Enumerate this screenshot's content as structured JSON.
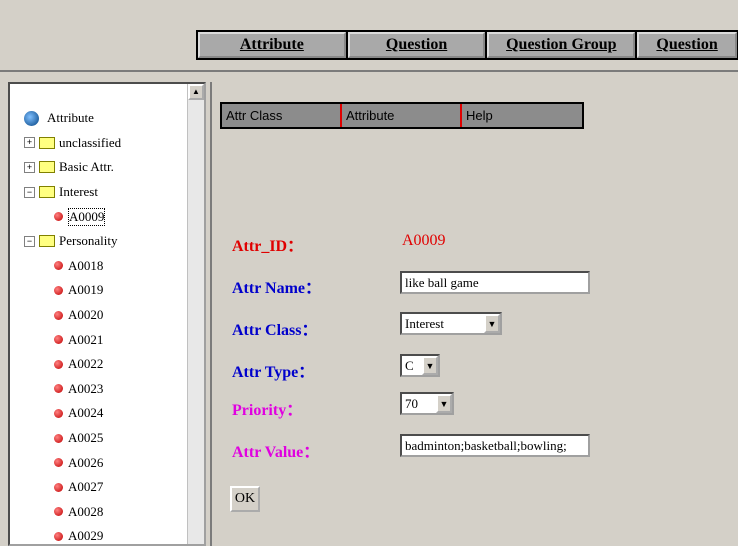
{
  "menu": {
    "items": [
      "Attribute",
      "Question",
      "Question Group",
      "Question"
    ]
  },
  "tree": {
    "root": "Attribute",
    "folders": [
      {
        "label": "unclassified",
        "expander": "+"
      },
      {
        "label": "Basic Attr.",
        "expander": "+"
      },
      {
        "label": "Interest",
        "expander": "−"
      }
    ],
    "interest_items": [
      "A0009"
    ],
    "personality": {
      "label": "Personality",
      "expander": "−"
    },
    "personality_items": [
      "A0018",
      "A0019",
      "A0020",
      "A0021",
      "A0022",
      "A0023",
      "A0024",
      "A0025",
      "A0026",
      "A0027",
      "A0028",
      "A0029"
    ]
  },
  "tabs": [
    "Attr Class",
    "Attribute",
    "Help"
  ],
  "form": {
    "attr_id_label": "Attr_ID：",
    "attr_id_value": "A0009",
    "attr_name_label": "Attr Name：",
    "attr_name_value": "like ball game",
    "attr_class_label": "Attr Class：",
    "attr_class_value": "Interest",
    "attr_type_label": "Attr Type：",
    "attr_type_value": "C",
    "priority_label": "Priority：",
    "priority_value": "70",
    "attr_value_label": "Attr Value：",
    "attr_value_value": "badminton;basketball;bowling;",
    "ok_label": "OK"
  },
  "colors": {
    "red": "#e00000",
    "blue": "#0000cc",
    "magenta": "#e000e0"
  }
}
